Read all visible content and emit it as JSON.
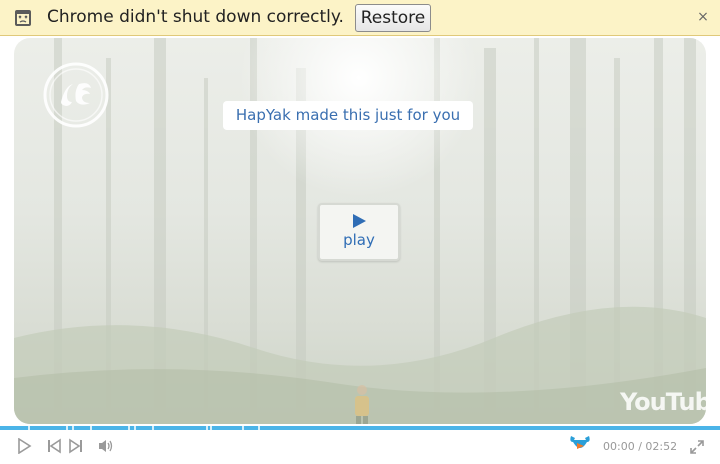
{
  "infobar": {
    "message": "Chrome didn't shut down correctly.",
    "restore_label": "Restore",
    "close_glyph": "×",
    "icon": "crashed-page-icon"
  },
  "video": {
    "promo_text": "HapYak made this just for you",
    "play_label": "play",
    "logo": "ge-logo",
    "watermark": "YouTube",
    "accent_color": "#2f6db5"
  },
  "player": {
    "time_text": "00:00 / 02:52",
    "progress_color": "#4bb4e8",
    "controls": [
      "play-icon",
      "previous-icon",
      "next-icon",
      "volume-icon",
      "hapyak-icon",
      "fullscreen-icon"
    ]
  }
}
